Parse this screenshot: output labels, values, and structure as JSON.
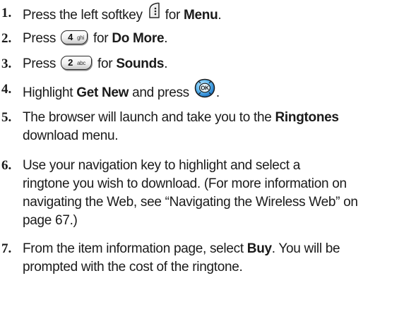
{
  "steps": [
    {
      "number": "1.",
      "pre": "Press the left softkey",
      "post": "for",
      "bold": "Menu",
      "tail": "."
    },
    {
      "number": "2.",
      "pre": "Press",
      "key_main": "4",
      "key_sub": "ghi",
      "post": "for",
      "bold": "Do More",
      "tail": "."
    },
    {
      "number": "3.",
      "pre": "Press",
      "key_main": "2",
      "key_sub": "abc",
      "post": "for",
      "bold": "Sounds",
      "tail": "."
    },
    {
      "number": "4.",
      "pre": "Highlight",
      "bold": "Get New",
      "post": "and press",
      "key_label": "OK",
      "tail": "."
    },
    {
      "number": "5.",
      "pre": "The browser will launch and take you to the",
      "bold": "Ringtones",
      "line2": "download menu."
    },
    {
      "number": "6.",
      "lines": [
        "Use your navigation key to highlight and select a",
        "ringtone you wish to download. (For more information on",
        "navigating the Web, see “Navigating the Wireless Web” on",
        "page 67.)"
      ]
    },
    {
      "number": "7.",
      "pre": "From the item information page, select",
      "bold": "Buy",
      "post": ". You will be",
      "line2": "prompted with the cost of the ringtone."
    }
  ],
  "icons": {
    "softkey": "left-softkey-icon",
    "ok": "ok-key-icon",
    "key4": "key-4-icon",
    "key2": "key-2-icon"
  }
}
